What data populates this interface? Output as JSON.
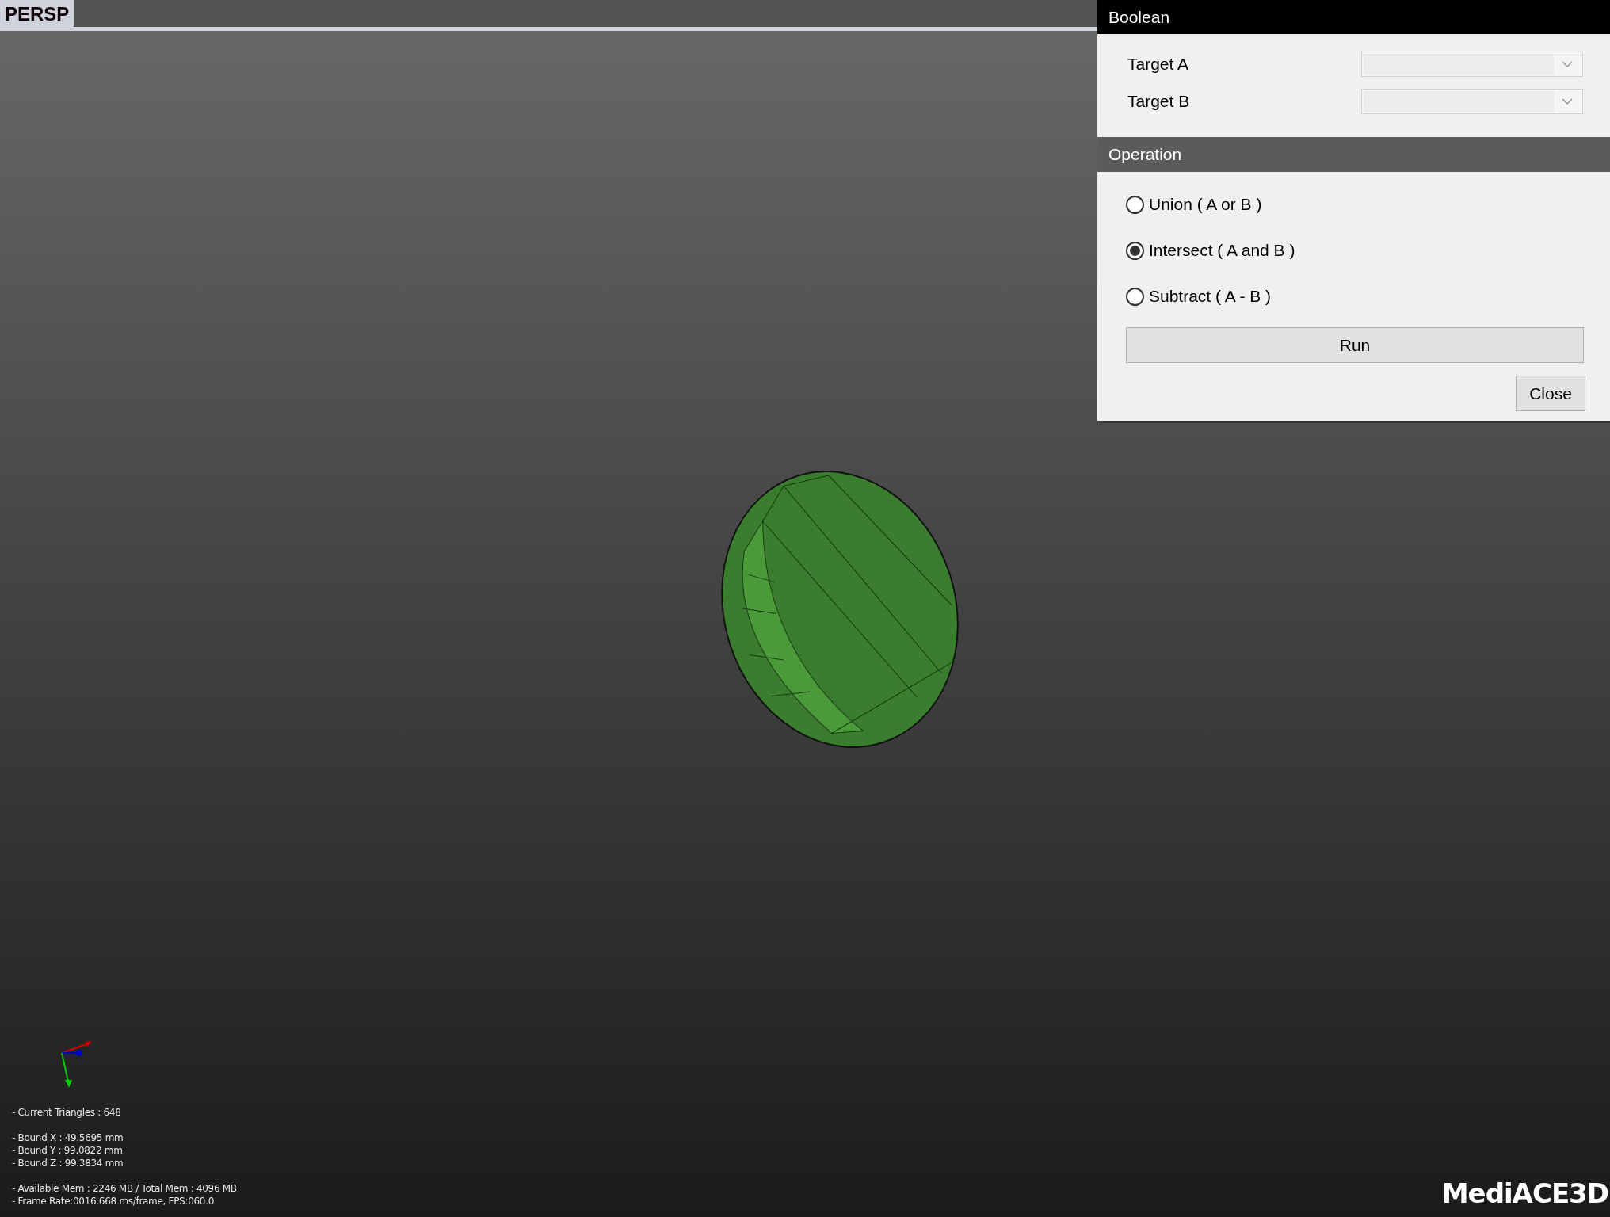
{
  "viewport": {
    "tab": "PERSP"
  },
  "stats": [
    [
      "- Current Triangles : 648"
    ],
    [
      "- Bound X : 49.5695 mm",
      "- Bound Y : 99.0822 mm",
      "- Bound Z : 99.3834 mm"
    ],
    [
      "- Available Mem : 2246 MB / Total Mem : 4096 MB",
      "- Frame Rate:0016.668 ms/frame, FPS:060.0"
    ]
  ],
  "logo": "MediACE3D",
  "panel": {
    "title": "Boolean",
    "targets": [
      {
        "label": "Target A"
      },
      {
        "label": "Target B"
      }
    ],
    "section": "Operation",
    "options": [
      {
        "label": "Union ( A or B )",
        "selected": false
      },
      {
        "label": "Intersect ( A and B )",
        "selected": true
      },
      {
        "label": "Subtract ( A - B )",
        "selected": false
      }
    ],
    "run_button": "Run",
    "close_button": "Close"
  }
}
